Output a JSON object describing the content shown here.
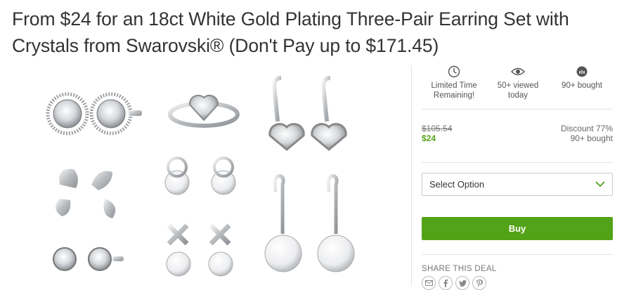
{
  "deal": {
    "title": "From $24 for an 18ct White Gold Plating Three-Pair Earring Set with Crystals from Swarovski® (Don't Pay up to $171.45)"
  },
  "stats": [
    {
      "icon": "clock-icon",
      "label": "Limited Time Remaining!"
    },
    {
      "icon": "eye-icon",
      "label": "50+ viewed today"
    },
    {
      "icon": "bought-bag-icon",
      "label": "90+ bought"
    }
  ],
  "pricing": {
    "original": "$105.54",
    "price": "$24",
    "discount": "Discount 77%",
    "bought": "90+ bought"
  },
  "option_select": {
    "label": "Select Option"
  },
  "buy_button": {
    "label": "Buy"
  },
  "share": {
    "title": "SHARE THIS DEAL",
    "icons": [
      "email-icon",
      "facebook-icon",
      "twitter-icon",
      "pinterest-icon"
    ]
  },
  "colors": {
    "accent_green": "#53a318",
    "text": "#333333"
  }
}
